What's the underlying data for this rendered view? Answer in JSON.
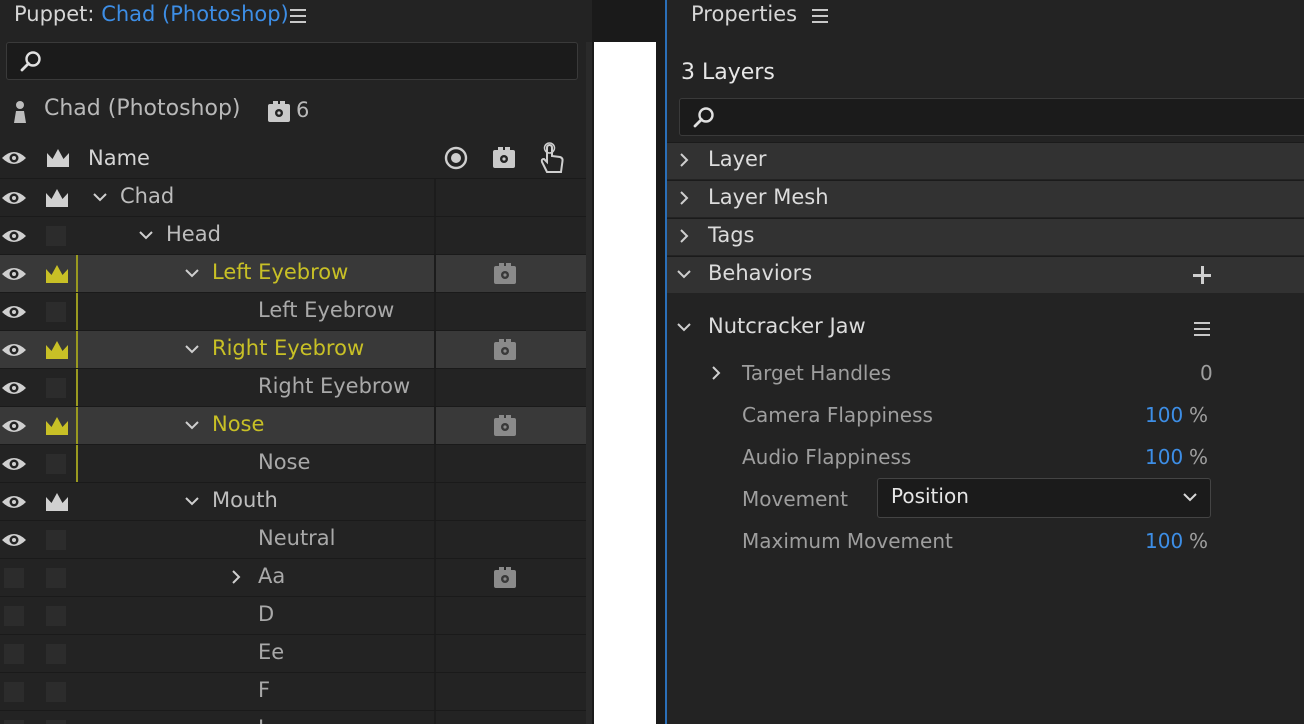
{
  "puppet_panel": {
    "title_prefix": "Puppet:",
    "title_link": "Chad (Photoshop)",
    "search_placeholder": "",
    "puppet_name": "Chad (Photoshop)",
    "behaviors_count": "6",
    "columns": {
      "name": "Name"
    },
    "rows": [
      {
        "label": "Chad",
        "level": 0,
        "expander": "down",
        "eye": true,
        "crown": "white",
        "behaviors": false,
        "selected": false,
        "yellow": false,
        "bar": false
      },
      {
        "label": "Head",
        "level": 1,
        "expander": "down",
        "eye": true,
        "crown": "box",
        "behaviors": false,
        "selected": false,
        "yellow": false,
        "bar": false
      },
      {
        "label": "Left Eyebrow",
        "level": 2,
        "expander": "down",
        "eye": true,
        "crown": "yellow",
        "behaviors": true,
        "selected": true,
        "yellow": true,
        "bar": true
      },
      {
        "label": "Left Eyebrow",
        "level": 3,
        "expander": "none",
        "eye": true,
        "crown": "box",
        "behaviors": false,
        "selected": false,
        "yellow": false,
        "bar": true
      },
      {
        "label": "Right Eyebrow",
        "level": 2,
        "expander": "down",
        "eye": true,
        "crown": "yellow",
        "behaviors": true,
        "selected": true,
        "yellow": true,
        "bar": true
      },
      {
        "label": "Right Eyebrow",
        "level": 3,
        "expander": "none",
        "eye": true,
        "crown": "box",
        "behaviors": false,
        "selected": false,
        "yellow": false,
        "bar": true
      },
      {
        "label": "Nose",
        "level": 2,
        "expander": "down",
        "eye": true,
        "crown": "yellow",
        "behaviors": true,
        "selected": true,
        "yellow": true,
        "bar": true
      },
      {
        "label": "Nose",
        "level": 3,
        "expander": "none",
        "eye": true,
        "crown": "box",
        "behaviors": false,
        "selected": false,
        "yellow": false,
        "bar": true
      },
      {
        "label": "Mouth",
        "level": 2,
        "expander": "down",
        "eye": true,
        "crown": "white",
        "behaviors": false,
        "selected": false,
        "yellow": false,
        "bar": false
      },
      {
        "label": "Neutral",
        "level": 3,
        "expander": "none",
        "eye": true,
        "crown": "box",
        "behaviors": false,
        "selected": false,
        "yellow": false,
        "bar": false
      },
      {
        "label": "Aa",
        "level": 3,
        "expander": "right",
        "eye": false,
        "crown": "box",
        "behaviors": true,
        "selected": false,
        "yellow": false,
        "bar": false
      },
      {
        "label": "D",
        "level": 3,
        "expander": "none",
        "eye": false,
        "crown": "box",
        "behaviors": false,
        "selected": false,
        "yellow": false,
        "bar": false
      },
      {
        "label": "Ee",
        "level": 3,
        "expander": "none",
        "eye": false,
        "crown": "box",
        "behaviors": false,
        "selected": false,
        "yellow": false,
        "bar": false
      },
      {
        "label": "F",
        "level": 3,
        "expander": "none",
        "eye": false,
        "crown": "box",
        "behaviors": false,
        "selected": false,
        "yellow": false,
        "bar": false
      },
      {
        "label": "L",
        "level": 3,
        "expander": "none",
        "eye": false,
        "crown": "box",
        "behaviors": false,
        "selected": false,
        "yellow": false,
        "bar": false
      }
    ]
  },
  "properties_panel": {
    "title": "Properties",
    "layers_count": "3 Layers",
    "search_placeholder": "",
    "sections": {
      "layer": "Layer",
      "layer_mesh": "Layer Mesh",
      "tags": "Tags",
      "behaviors": "Behaviors"
    },
    "behavior": {
      "name": "Nutcracker Jaw",
      "target_handles_label": "Target Handles",
      "target_handles_value": "0",
      "camera_flappiness_label": "Camera Flappiness",
      "camera_flappiness_value": "100",
      "audio_flappiness_label": "Audio Flappiness",
      "audio_flappiness_value": "100",
      "movement_label": "Movement",
      "movement_value": "Position",
      "max_movement_label": "Maximum Movement",
      "max_movement_value": "100",
      "percent_unit": "%"
    }
  },
  "colors": {
    "accent_blue": "#3d8ee6",
    "selection_yellow": "#c8c026"
  }
}
